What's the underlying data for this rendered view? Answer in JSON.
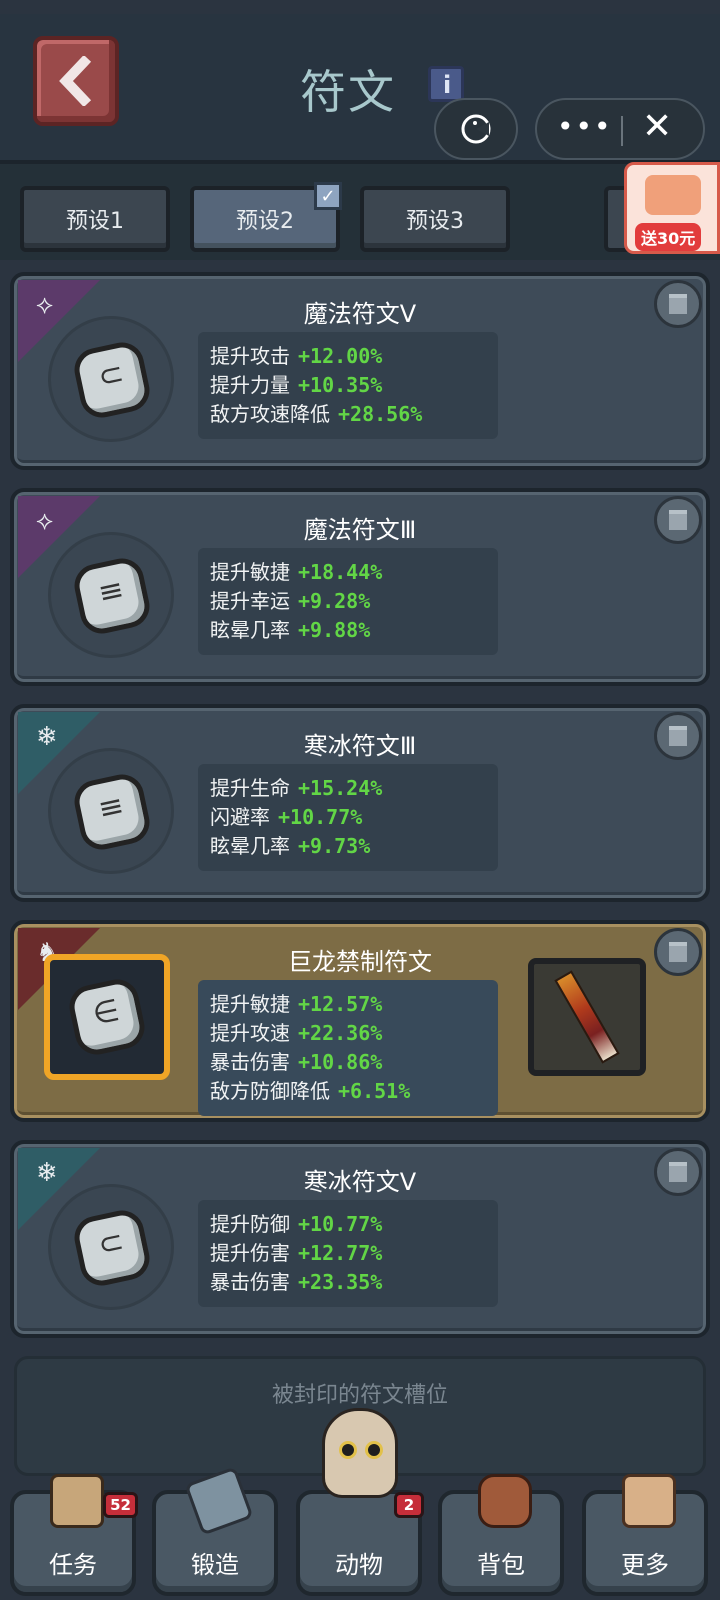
{
  "header": {
    "title": "符文"
  },
  "presets": [
    {
      "label": "预设1",
      "active": false
    },
    {
      "label": "预设2",
      "active": true
    },
    {
      "label": "预设3",
      "active": false
    }
  ],
  "promo": {
    "label": "送30元"
  },
  "runes": [
    {
      "name": "魔法符文Ⅴ",
      "element": "magic",
      "tag_icon": "magic-eye-icon",
      "mark": "⊂",
      "stats": [
        {
          "label": "提升攻击",
          "value": "+12.00%"
        },
        {
          "label": "提升力量",
          "value": "+10.35%"
        },
        {
          "label": "敌方攻速降低",
          "value": "+28.56%"
        }
      ]
    },
    {
      "name": "魔法符文Ⅲ",
      "element": "magic",
      "tag_icon": "magic-eye-icon",
      "mark": "≡",
      "stats": [
        {
          "label": "提升敏捷",
          "value": "+18.44%"
        },
        {
          "label": "提升幸运",
          "value": "+9.28%"
        },
        {
          "label": "眩晕几率",
          "value": "+9.88%"
        }
      ]
    },
    {
      "name": "寒冰符文Ⅲ",
      "element": "ice",
      "tag_icon": "snowflake-icon",
      "mark": "≡",
      "stats": [
        {
          "label": "提升生命",
          "value": "+15.24%"
        },
        {
          "label": "闪避率",
          "value": "+10.77%"
        },
        {
          "label": "眩晕几率",
          "value": "+9.73%"
        }
      ]
    },
    {
      "name": "巨龙禁制符文",
      "element": "dragon",
      "tag_icon": "dragon-icon",
      "mark": "∈",
      "stats": [
        {
          "label": "提升敏捷",
          "value": "+12.57%"
        },
        {
          "label": "提升攻速",
          "value": "+22.36%"
        },
        {
          "label": "暴击伤害",
          "value": "+10.86%"
        },
        {
          "label": "敌方防御降低",
          "value": "+6.51%"
        }
      ]
    },
    {
      "name": "寒冰符文Ⅴ",
      "element": "ice",
      "tag_icon": "snowflake-icon",
      "mark": "⊂",
      "stats": [
        {
          "label": "提升防御",
          "value": "+10.77%"
        },
        {
          "label": "提升伤害",
          "value": "+12.77%"
        },
        {
          "label": "暴击伤害",
          "value": "+23.35%"
        }
      ]
    }
  ],
  "sealed_slot": {
    "label": "被封印的符文槽位"
  },
  "nav": [
    {
      "label": "任务",
      "icon": "quest-book-icon",
      "badge": "52"
    },
    {
      "label": "锻造",
      "icon": "hammer-icon",
      "badge": null
    },
    {
      "label": "动物",
      "icon": "pet-icon",
      "badge": "2"
    },
    {
      "label": "背包",
      "icon": "backpack-icon",
      "badge": null
    },
    {
      "label": "更多",
      "icon": "grid-icon",
      "badge": null
    }
  ],
  "colors": {
    "stat_value": "#62d646",
    "magic_tag": "#5c3a6a",
    "ice_tag": "#2f5d66",
    "dragon_tag": "#6a2c2c",
    "legendary_card": "#7d6c45",
    "legendary_frame": "#f0a526"
  }
}
